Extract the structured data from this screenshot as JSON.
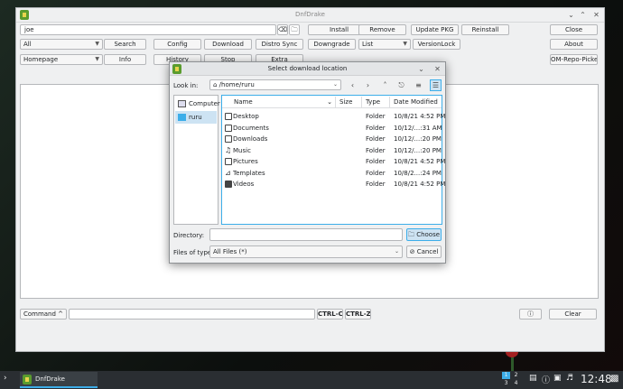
{
  "window": {
    "title": "DnfDrake"
  },
  "toolbar": {
    "search_value": "joe",
    "install": "Install",
    "remove": "Remove",
    "update_pkg": "Update PKG",
    "reinstall": "Reinstall",
    "close": "Close",
    "filter_combo": "All",
    "search": "Search",
    "config": "Config",
    "download": "Download",
    "distro_sync": "Distro Sync",
    "downgrade": "Downgrade",
    "list_combo": "List",
    "versionlock": "VersionLock",
    "about": "About",
    "homepage_combo": "Homepage",
    "info": "Info",
    "history": "History",
    "stop": "Stop",
    "extra": "Extra",
    "om_repo_picker": "OM-Repo-Picker"
  },
  "bottom": {
    "command": "Command ^",
    "ctrl_c": "CTRL-C",
    "ctrl_z": "CTRL-Z",
    "clear": "Clear"
  },
  "dialog": {
    "title": "Select download location",
    "look_in_label": "Look in:",
    "look_in_path": "/home/ruru",
    "places": [
      {
        "label": "Computer"
      },
      {
        "label": "ruru"
      }
    ],
    "columns": [
      "Name",
      "Size",
      "Type",
      "Date Modified"
    ],
    "files": [
      {
        "name": "Desktop",
        "size": "",
        "type": "Folder",
        "date": "10/8/21 4:52 PM"
      },
      {
        "name": "Documents",
        "size": "",
        "type": "Folder",
        "date": "10/12/...:31 AM"
      },
      {
        "name": "Downloads",
        "size": "",
        "type": "Folder",
        "date": "10/12/...:20 PM"
      },
      {
        "name": "Music",
        "size": "",
        "type": "Folder",
        "date": "10/12/...:20 PM"
      },
      {
        "name": "Pictures",
        "size": "",
        "type": "Folder",
        "date": "10/8/21 4:52 PM"
      },
      {
        "name": "Templates",
        "size": "",
        "type": "Folder",
        "date": "10/8/2...:24 PM"
      },
      {
        "name": "Videos",
        "size": "",
        "type": "Folder",
        "date": "10/8/21 4:52 PM"
      }
    ],
    "directory_label": "Directory:",
    "directory_value": "",
    "choose": "Choose",
    "files_of_type_label": "Files of type:",
    "files_of_type_value": "All Files (*)",
    "cancel": "Cancel"
  },
  "taskbar": {
    "app_label": "DnfDrake",
    "pager": [
      "1",
      "2",
      "3",
      "4"
    ],
    "clock": "12:48"
  },
  "colors": {
    "accent": "#3daee9",
    "selected": "#cde3f3",
    "taskbar": "#2a2e32"
  }
}
